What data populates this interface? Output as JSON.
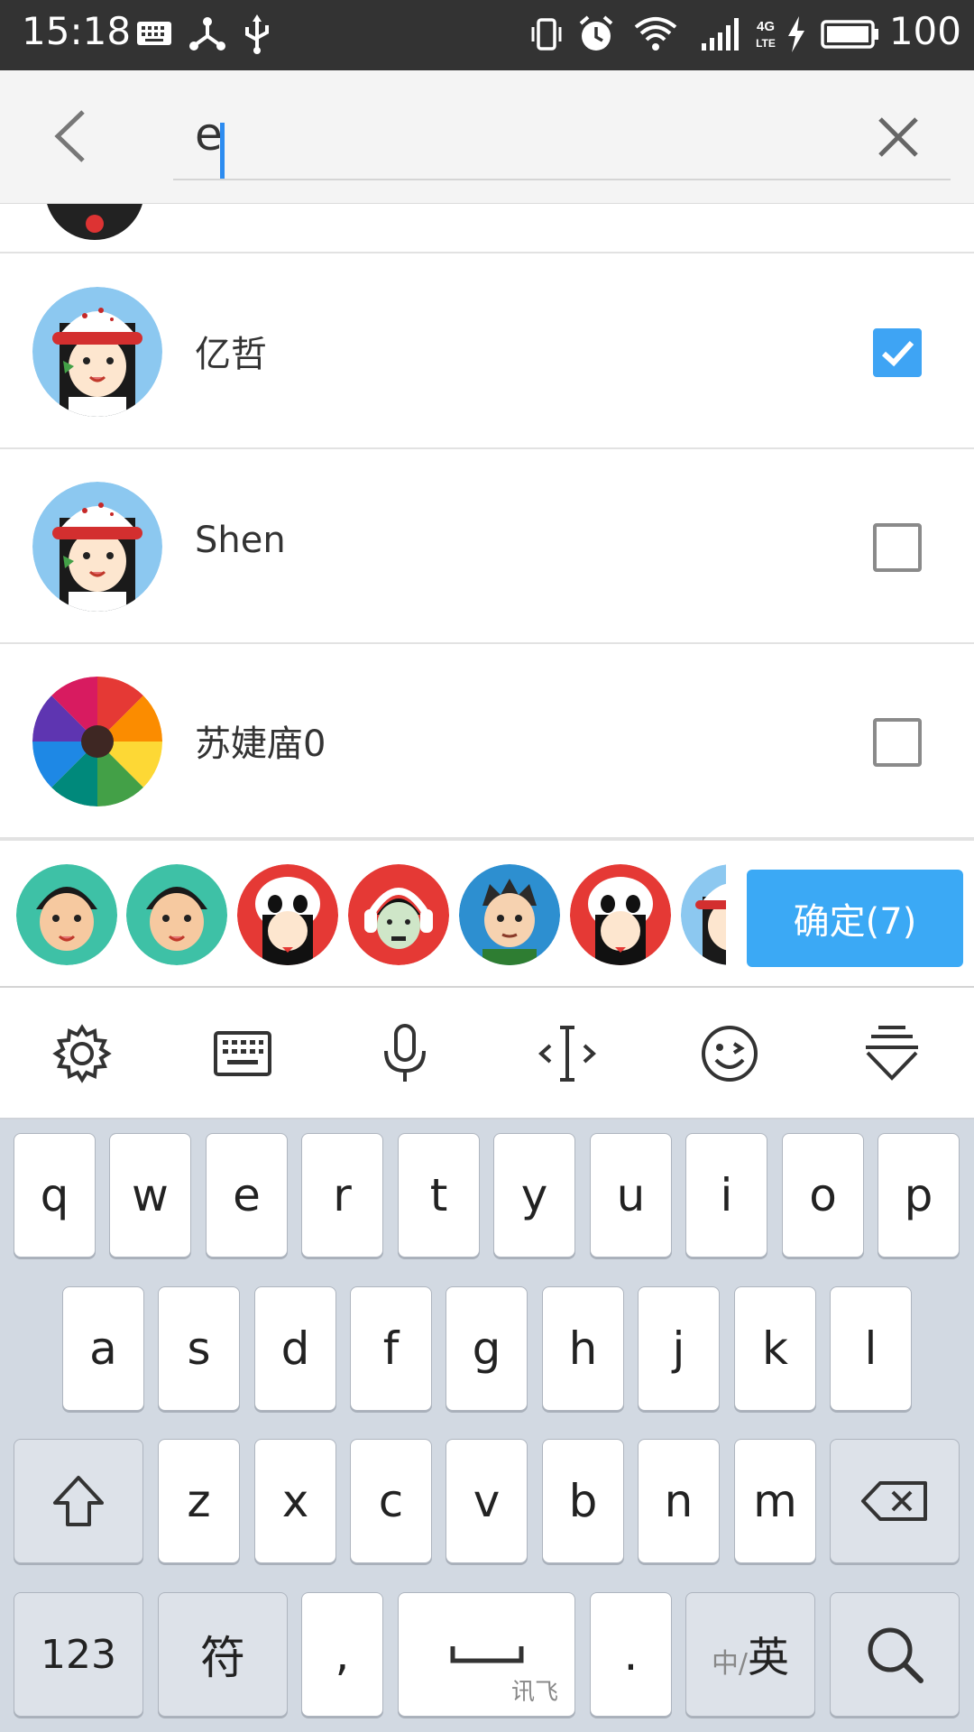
{
  "status_bar": {
    "time": "15:18",
    "battery_level": "100",
    "icons": [
      "keyboard-icon",
      "share-network-icon",
      "usb-icon",
      "vibrate-icon",
      "alarm-icon",
      "wifi-icon",
      "signal-icon",
      "4g-lte-icon",
      "charging-icon",
      "battery-icon"
    ],
    "network_label": "4G LTE"
  },
  "search": {
    "query": "e"
  },
  "contacts": [
    {
      "name": "亿哲",
      "checked": true,
      "avatar": "girl-red-cap"
    },
    {
      "name": "Shen",
      "checked": false,
      "avatar": "girl-red-cap"
    },
    {
      "name": "苏婕庿0",
      "checked": false,
      "avatar": "color-pencils"
    }
  ],
  "selected": {
    "avatars": [
      "boy-teal",
      "boy-teal",
      "panda-girl",
      "headphone-boy",
      "spiky-boy",
      "panda-girl",
      "girl-red-cap"
    ],
    "confirm_label": "确定(7)"
  },
  "ime_toolbar": {
    "tools": [
      "settings-icon",
      "keyboard-layout-icon",
      "microphone-icon",
      "cursor-move-icon",
      "emoji-icon",
      "collapse-keyboard-icon"
    ]
  },
  "keyboard": {
    "row1": [
      "q",
      "w",
      "e",
      "r",
      "t",
      "y",
      "u",
      "i",
      "o",
      "p"
    ],
    "row2": [
      "a",
      "s",
      "d",
      "f",
      "g",
      "h",
      "j",
      "k",
      "l"
    ],
    "row3": [
      "z",
      "x",
      "c",
      "v",
      "b",
      "n",
      "m"
    ],
    "num_label": "123",
    "symbol_label": "符",
    "comma_label": ",",
    "space_brand": "讯飞",
    "period_label": ".",
    "lang_small": "中/",
    "lang_big": "英"
  },
  "colors": {
    "accent": "#3ba9f5",
    "status_bar": "#333333",
    "keyboard_bg": "#d2d9e2"
  }
}
